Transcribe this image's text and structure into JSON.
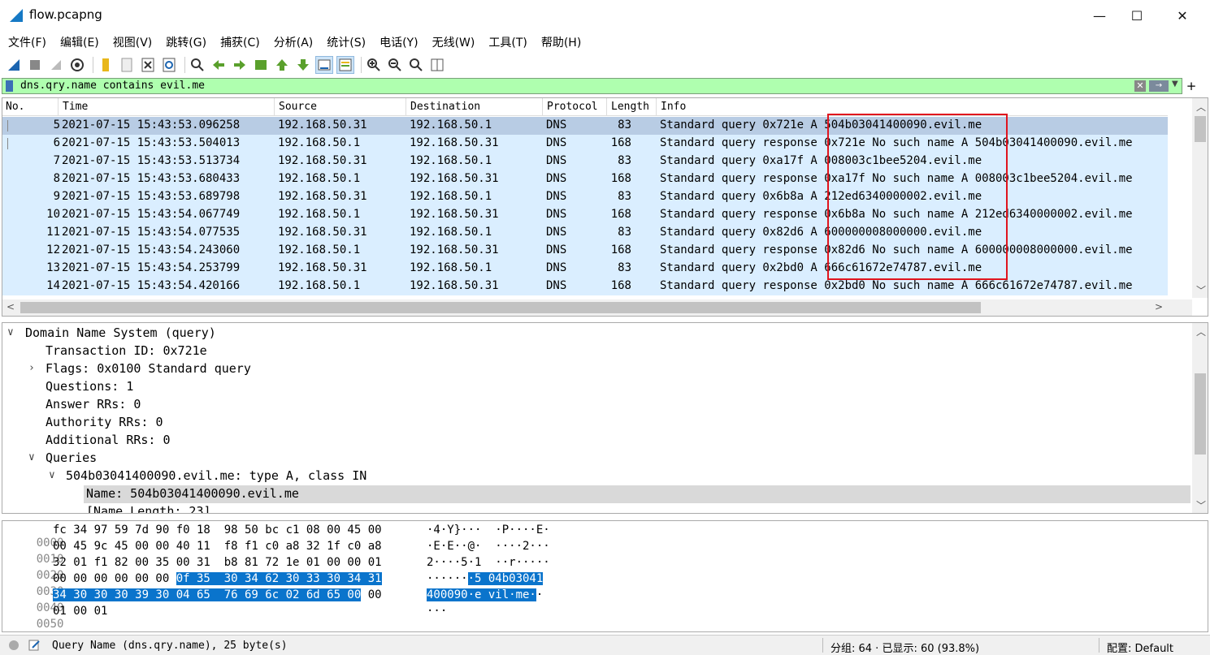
{
  "window": {
    "title": "flow.pcapng",
    "minimize": "—",
    "maximize": "☐",
    "close": "✕"
  },
  "menu": [
    "文件(F)",
    "编辑(E)",
    "视图(V)",
    "跳转(G)",
    "捕获(C)",
    "分析(A)",
    "统计(S)",
    "电话(Y)",
    "无线(W)",
    "工具(T)",
    "帮助(H)"
  ],
  "toolbar": {
    "icons": [
      "shark-fin-start-icon",
      "stop-icon",
      "restart-icon",
      "options-gear-icon",
      "open-folder-icon",
      "file-icon",
      "close-file-icon",
      "reload-icon",
      "find-icon",
      "back-arrow-icon",
      "forward-arrow-icon",
      "goto-packet-icon",
      "first-packet-icon",
      "last-packet-icon",
      "autoscroll-icon",
      "colorize-icon",
      "zoom-in-icon",
      "zoom-out-icon",
      "normal-size-icon",
      "resize-columns-icon"
    ]
  },
  "filter": {
    "value": "dns.qry.name contains evil.me",
    "clear": "✕",
    "apply": "→",
    "dropdown": "▼",
    "add": "+"
  },
  "packet_list": {
    "columns": [
      "No.",
      "Time",
      "Source",
      "Destination",
      "Protocol",
      "Length",
      "Info"
    ],
    "rows": [
      {
        "no": "5",
        "time": "2021-07-15 15:43:53.096258",
        "src": "192.168.50.31",
        "dst": "192.168.50.1",
        "proto": "DNS",
        "len": "83",
        "info": "Standard query 0x721e A 504b03041400090.evil.me"
      },
      {
        "no": "6",
        "time": "2021-07-15 15:43:53.504013",
        "src": "192.168.50.1",
        "dst": "192.168.50.31",
        "proto": "DNS",
        "len": "168",
        "info": "Standard query response 0x721e No such name A 504b03041400090.evil.me"
      },
      {
        "no": "7",
        "time": "2021-07-15 15:43:53.513734",
        "src": "192.168.50.31",
        "dst": "192.168.50.1",
        "proto": "DNS",
        "len": "83",
        "info": "Standard query 0xa17f A 008003c1bee5204.evil.me"
      },
      {
        "no": "8",
        "time": "2021-07-15 15:43:53.680433",
        "src": "192.168.50.1",
        "dst": "192.168.50.31",
        "proto": "DNS",
        "len": "168",
        "info": "Standard query response 0xa17f No such name A 008003c1bee5204.evil.me"
      },
      {
        "no": "9",
        "time": "2021-07-15 15:43:53.689798",
        "src": "192.168.50.31",
        "dst": "192.168.50.1",
        "proto": "DNS",
        "len": "83",
        "info": "Standard query 0x6b8a A 212ed6340000002.evil.me"
      },
      {
        "no": "10",
        "time": "2021-07-15 15:43:54.067749",
        "src": "192.168.50.1",
        "dst": "192.168.50.31",
        "proto": "DNS",
        "len": "168",
        "info": "Standard query response 0x6b8a No such name A 212ed6340000002.evil.me"
      },
      {
        "no": "11",
        "time": "2021-07-15 15:43:54.077535",
        "src": "192.168.50.31",
        "dst": "192.168.50.1",
        "proto": "DNS",
        "len": "83",
        "info": "Standard query 0x82d6 A 600000008000000.evil.me"
      },
      {
        "no": "12",
        "time": "2021-07-15 15:43:54.243060",
        "src": "192.168.50.1",
        "dst": "192.168.50.31",
        "proto": "DNS",
        "len": "168",
        "info": "Standard query response 0x82d6 No such name A 600000008000000.evil.me"
      },
      {
        "no": "13",
        "time": "2021-07-15 15:43:54.253799",
        "src": "192.168.50.31",
        "dst": "192.168.50.1",
        "proto": "DNS",
        "len": "83",
        "info": "Standard query 0x2bd0 A 666c61672e74787.evil.me"
      },
      {
        "no": "14",
        "time": "2021-07-15 15:43:54.420166",
        "src": "192.168.50.1",
        "dst": "192.168.50.31",
        "proto": "DNS",
        "len": "168",
        "info": "Standard query response 0x2bd0 No such name A 666c61672e74787.evil.me"
      }
    ],
    "selected_row": "5",
    "row_color": "#daeeff",
    "selected_color": "#b8cce4",
    "annotation_color": "#e0141e"
  },
  "details": {
    "lines": [
      {
        "toggle": "∨",
        "text": "Domain Name System (query)"
      },
      {
        "toggle": "",
        "text": "Transaction ID: 0x721e"
      },
      {
        "toggle": "›",
        "text": "Flags: 0x0100 Standard query"
      },
      {
        "toggle": "",
        "text": "Questions: 1"
      },
      {
        "toggle": "",
        "text": "Answer RRs: 0"
      },
      {
        "toggle": "",
        "text": "Authority RRs: 0"
      },
      {
        "toggle": "",
        "text": "Additional RRs: 0"
      },
      {
        "toggle": "∨",
        "text": "Queries"
      },
      {
        "toggle": "∨",
        "text": "504b03041400090.evil.me: type A, class IN"
      },
      {
        "toggle": "",
        "text": "Name: 504b03041400090.evil.me"
      },
      {
        "toggle": "",
        "text": "[Name Length: 23]"
      }
    ]
  },
  "hex": {
    "lines": [
      {
        "offset": "0000",
        "pre": "fc 34 97 59 7d 90 f0 18  98 50 bc c1 08 00 45 00",
        "hl": "",
        "post": "",
        "ascii_pre": "·4·Y}···  ·P····E·",
        "ascii_hl": "",
        "ascii_post": ""
      },
      {
        "offset": "0010",
        "pre": "00 45 9c 45 00 00 40 11  f8 f1 c0 a8 32 1f c0 a8",
        "hl": "",
        "post": "",
        "ascii_pre": "·E·E··@·  ····2···",
        "ascii_hl": "",
        "ascii_post": ""
      },
      {
        "offset": "0020",
        "pre": "32 01 f1 82 00 35 00 31  b8 81 72 1e 01 00 00 01",
        "hl": "",
        "post": "",
        "ascii_pre": "2····5·1  ··r·····",
        "ascii_hl": "",
        "ascii_post": ""
      },
      {
        "offset": "0030",
        "pre": "00 00 00 00 00 00 ",
        "hl": "0f 35  30 34 62 30 33 30 34 31",
        "post": "",
        "ascii_pre": "······",
        "ascii_hl": "·5 04b03041",
        "ascii_post": ""
      },
      {
        "offset": "0040",
        "pre": "",
        "hl": "34 30 30 30 39 30 04 65  76 69 6c 02 6d 65 00",
        "post": " 00",
        "ascii_pre": "",
        "ascii_hl": "400090·e vil·me·",
        "ascii_post": "·"
      },
      {
        "offset": "0050",
        "pre": "01 00 01",
        "hl": "",
        "post": "",
        "ascii_pre": "···",
        "ascii_hl": "",
        "ascii_post": ""
      }
    ],
    "highlight_color": "#0a74cc"
  },
  "status": {
    "field": "Query Name (dns.qry.name), 25 byte(s)",
    "packets": "分组: 64 · 已显示: 60 (93.8%)",
    "profile": "配置: Default"
  }
}
